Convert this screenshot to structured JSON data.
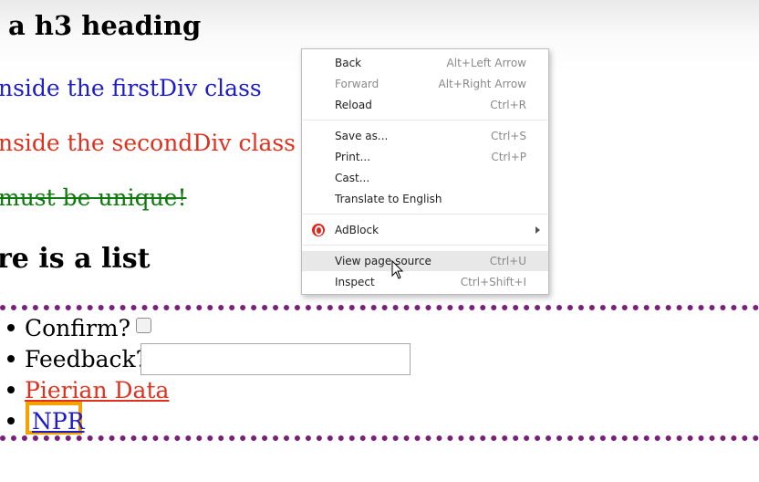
{
  "page": {
    "h3": "a h3 heading",
    "first_div": "nside the firstDiv class",
    "second_div": "nside the secondDiv class",
    "unique": "must be unique!",
    "list_heading": "re is a list",
    "items": {
      "confirm": "Confirm?",
      "feedback": "Feedback?",
      "pierian": "Pierian Data",
      "npr": "NPR"
    }
  },
  "context_menu": {
    "back": {
      "label": "Back",
      "shortcut": "Alt+Left Arrow"
    },
    "forward": {
      "label": "Forward",
      "shortcut": "Alt+Right Arrow"
    },
    "reload": {
      "label": "Reload",
      "shortcut": "Ctrl+R"
    },
    "save_as": {
      "label": "Save as...",
      "shortcut": "Ctrl+S"
    },
    "print": {
      "label": "Print...",
      "shortcut": "Ctrl+P"
    },
    "cast": {
      "label": "Cast..."
    },
    "translate": {
      "label": "Translate to English"
    },
    "adblock": {
      "label": "AdBlock"
    },
    "view_source": {
      "label": "View page source",
      "shortcut": "Ctrl+U"
    },
    "inspect": {
      "label": "Inspect",
      "shortcut": "Ctrl+Shift+I"
    }
  },
  "colors": {
    "link_blue": "#1c1cc8",
    "text_red": "#e0301e",
    "text_green": "#0e7a0e",
    "dotted_border": "#7a1f7a",
    "highlight_orange": "#f5a100",
    "adblock_red": "#e1251b"
  },
  "icons": [
    "adblock-icon",
    "submenu-arrow-icon",
    "mouse-cursor-icon"
  ]
}
